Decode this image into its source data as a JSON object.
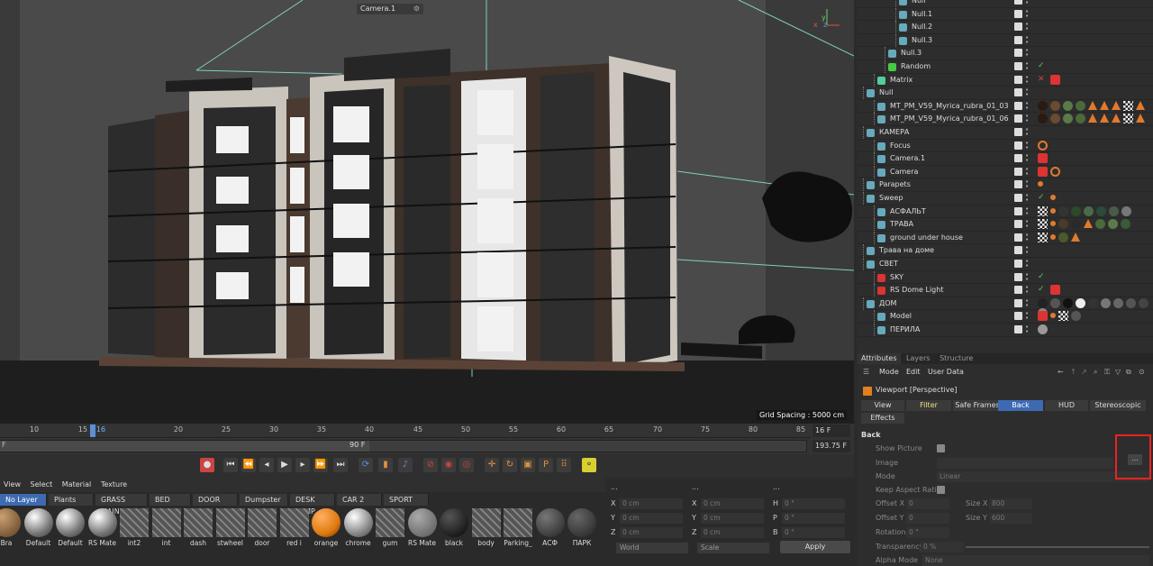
{
  "viewport": {
    "camera_label": "Camera.1",
    "grid_spacing": "Grid Spacing : 5000 cm",
    "axis_labels": {
      "x": "x",
      "y": "y",
      "z": "z"
    }
  },
  "timeline": {
    "ticks": [
      "10",
      "15",
      "16",
      "20",
      "25",
      "30",
      "35",
      "40",
      "45",
      "50",
      "55",
      "60",
      "65",
      "70",
      "75",
      "80",
      "85",
      "90"
    ],
    "current_frame": "16 F",
    "left_frame": "F",
    "end_frame": "90 F",
    "total": "193.75 F"
  },
  "material_manager": {
    "menu": [
      "View",
      "Select",
      "Material",
      "Texture"
    ],
    "layers": [
      "No Layer",
      "Plants",
      "GRASS MAIN",
      "BED",
      "DOOR",
      "Dumpster",
      "DESK LAMP",
      "CAR 2",
      "SPORT"
    ],
    "materials": [
      "Bra",
      "Default",
      "Default",
      "RS Mate",
      "int2",
      "int",
      "dash",
      "stwheel",
      "door",
      "red i",
      "orange",
      "chrome",
      "gum",
      "RS Mate",
      "black",
      "body",
      "Parking_",
      "АСФ",
      "ПАРК"
    ]
  },
  "coordinates": {
    "rows": [
      {
        "a": "X",
        "av": "0 cm",
        "b": "X",
        "bv": "0 cm",
        "c": "H",
        "cv": "0 °"
      },
      {
        "a": "Y",
        "av": "0 cm",
        "b": "Y",
        "bv": "0 cm",
        "c": "P",
        "cv": "0 °"
      },
      {
        "a": "Z",
        "av": "0 cm",
        "b": "Z",
        "bv": "0 cm",
        "c": "B",
        "cv": "0 °"
      }
    ],
    "header": "...",
    "world": "World",
    "scale": "Scale",
    "apply": "Apply"
  },
  "object_manager": {
    "items": [
      {
        "name": "Null",
        "indent": 3
      },
      {
        "name": "Null.1",
        "indent": 3
      },
      {
        "name": "Null.2",
        "indent": 3
      },
      {
        "name": "Null.3",
        "indent": 3
      },
      {
        "name": "Null.3",
        "indent": 2
      },
      {
        "name": "Random",
        "indent": 2
      },
      {
        "name": "Matrix",
        "indent": 1
      },
      {
        "name": "Null",
        "indent": 0
      },
      {
        "name": "MT_PM_V59_Myrica_rubra_01_03",
        "indent": 1
      },
      {
        "name": "MT_PM_V59_Myrica_rubra_01_06",
        "indent": 1
      },
      {
        "name": "КАМЕРА",
        "indent": 0
      },
      {
        "name": "Focus",
        "indent": 1
      },
      {
        "name": "Camera.1",
        "indent": 1
      },
      {
        "name": "Camera",
        "indent": 1
      },
      {
        "name": "Parapets",
        "indent": 0
      },
      {
        "name": "Sweep",
        "indent": 0
      },
      {
        "name": "АСФАЛЬТ",
        "indent": 1
      },
      {
        "name": "ТРАВА",
        "indent": 1
      },
      {
        "name": "ground under house",
        "indent": 1
      },
      {
        "name": "Трава на доме",
        "indent": 0
      },
      {
        "name": "СВЕТ",
        "indent": 0
      },
      {
        "name": "SKY",
        "indent": 1
      },
      {
        "name": "RS Dome Light",
        "indent": 1
      },
      {
        "name": "ДОМ",
        "indent": 0
      },
      {
        "name": "Model",
        "indent": 1
      },
      {
        "name": "ПЕРИЛА",
        "indent": 1
      }
    ]
  },
  "attributes": {
    "tabs": [
      "Attributes",
      "Layers",
      "Structure"
    ],
    "menu": [
      "Mode",
      "Edit",
      "User Data"
    ],
    "title": "Viewport [Perspective]",
    "subtabs": [
      "View",
      "Filter",
      "Safe Frames",
      "Back",
      "HUD",
      "Stereoscopic",
      "Effects"
    ],
    "section": "Back",
    "show_picture": "Show Picture",
    "image": "Image",
    "mode": "Mode",
    "mode_value": "Linear",
    "keep_aspect": "Keep Aspect Ratio",
    "offset_x": "Offset X",
    "offset_x_val": "0",
    "offset_y": "Offset Y",
    "offset_y_val": "0",
    "size_x": "Size X",
    "size_x_val": "800",
    "size_y": "Size Y",
    "size_y_val": "600",
    "rotation": "Rotation",
    "rotation_val": "0 °",
    "transparency": "Transparency",
    "transparency_val": "0 %",
    "alpha_mode": "Alpha Mode",
    "alpha_mode_val": "None",
    "dots": "..."
  },
  "colors": {
    "accent": "#3d6ab3",
    "highlight": "#e22222"
  }
}
